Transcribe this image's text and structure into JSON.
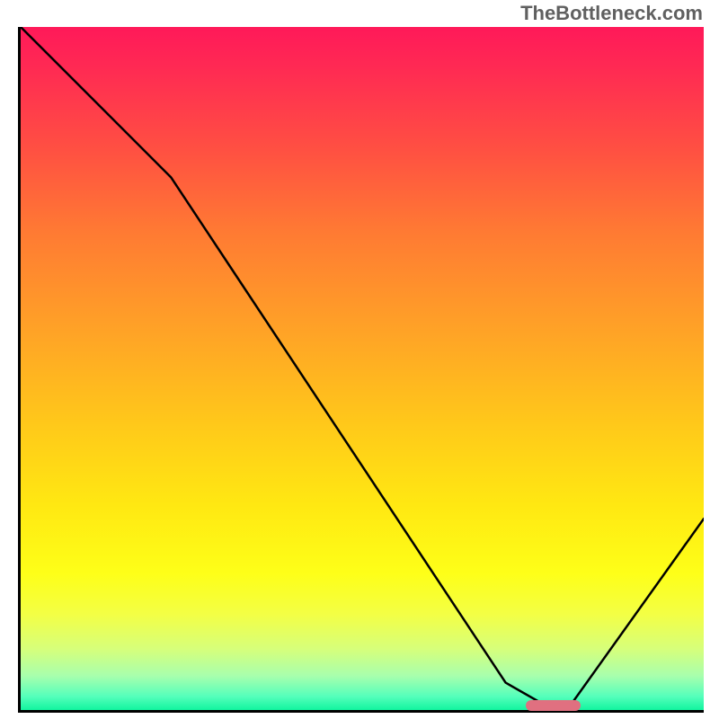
{
  "watermark": "TheBottleneck.com",
  "chart_data": {
    "type": "line",
    "title": "",
    "xlabel": "",
    "ylabel": "",
    "xlim": [
      0,
      100
    ],
    "ylim": [
      0,
      100
    ],
    "grid": false,
    "legend": false,
    "annotations": "Gradient background from red (top, high bottleneck) through orange/yellow to green (bottom, low bottleneck). Pink marker at curve minimum.",
    "series": [
      {
        "name": "bottleneck-curve",
        "x": [
          0,
          22,
          71,
          78,
          80,
          100
        ],
        "y": [
          100,
          78,
          4,
          0,
          0,
          28
        ]
      }
    ],
    "optimal_marker": {
      "x_start": 74,
      "x_end": 82,
      "y": 0.7
    },
    "gradient_stops": [
      {
        "pos": 0,
        "color": "#ff1959"
      },
      {
        "pos": 18,
        "color": "#ff5042"
      },
      {
        "pos": 45,
        "color": "#ffa426"
      },
      {
        "pos": 70,
        "color": "#ffe812"
      },
      {
        "pos": 86,
        "color": "#f3ff45"
      },
      {
        "pos": 95,
        "color": "#a8ffad"
      },
      {
        "pos": 100,
        "color": "#12f59f"
      }
    ]
  }
}
